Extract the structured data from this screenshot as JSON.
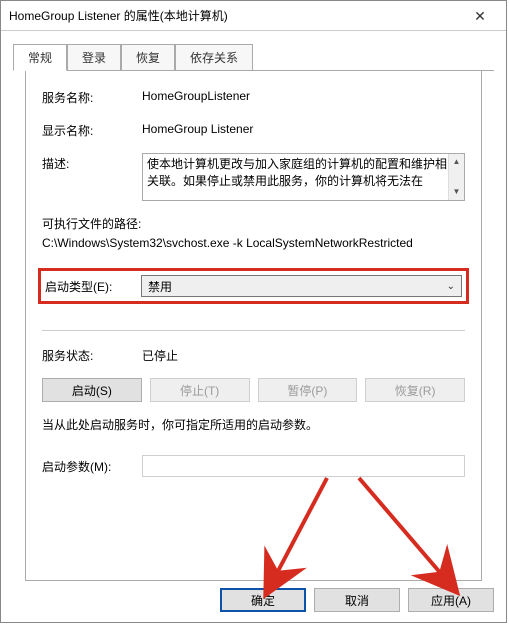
{
  "window": {
    "title": "HomeGroup Listener 的属性(本地计算机)"
  },
  "tabs": {
    "general": "常规",
    "logon": "登录",
    "recovery": "恢复",
    "dependencies": "依存关系"
  },
  "general": {
    "service_name_label": "服务名称:",
    "service_name": "HomeGroupListener",
    "display_name_label": "显示名称:",
    "display_name": "HomeGroup Listener",
    "description_label": "描述:",
    "description": "使本地计算机更改与加入家庭组的计算机的配置和维护相关联。如果停止或禁用此服务，你的计算机将无法在",
    "exe_path_label": "可执行文件的路径:",
    "exe_path": "C:\\Windows\\System32\\svchost.exe -k LocalSystemNetworkRestricted",
    "startup_type_label": "启动类型(E):",
    "startup_type_value": "禁用",
    "service_status_label": "服务状态:",
    "service_status_value": "已停止",
    "buttons": {
      "start": "启动(S)",
      "stop": "停止(T)",
      "pause": "暂停(P)",
      "resume": "恢复(R)"
    },
    "start_note": "当从此处启动服务时，你可指定所适用的启动参数。",
    "start_params_label": "启动参数(M):",
    "start_params_value": ""
  },
  "dialog": {
    "ok": "确定",
    "cancel": "取消",
    "apply": "应用(A)"
  }
}
